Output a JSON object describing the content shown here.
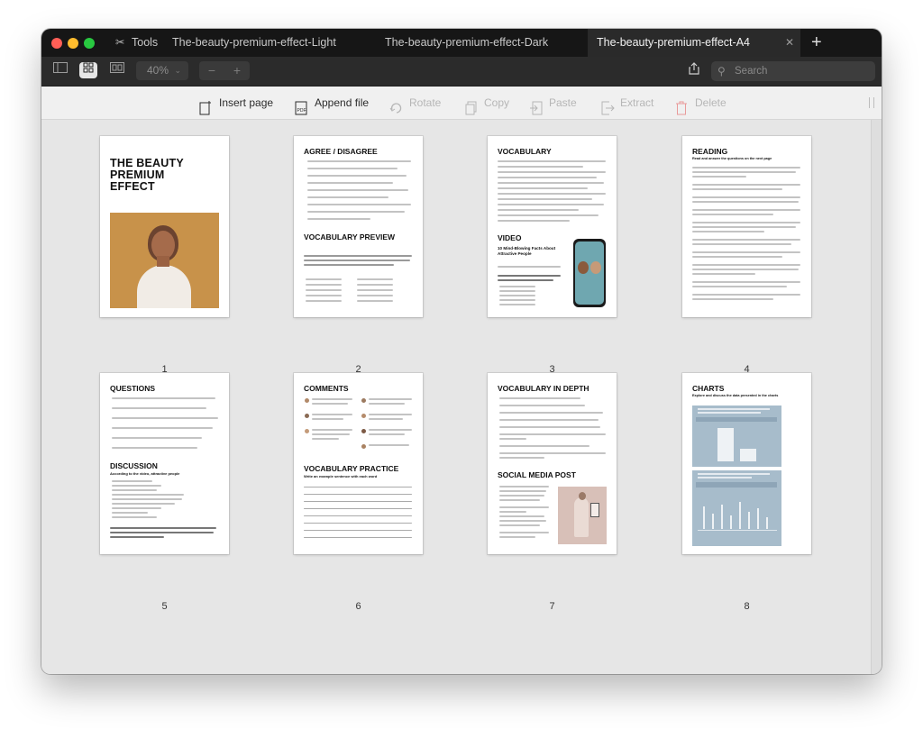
{
  "window": {
    "tabs": {
      "tools_label": "Tools",
      "tab1": "The-beauty-premium-effect-Light",
      "tab2": "The-beauty-premium-effect-Dark",
      "tab3": "The-beauty-premium-effect-A4"
    }
  },
  "toolbar": {
    "zoom": "40%",
    "search_placeholder": "Search"
  },
  "actions": {
    "insert_page": "Insert page",
    "append_file": "Append file",
    "rotate": "Rotate",
    "copy": "Copy",
    "paste": "Paste",
    "extract": "Extract",
    "delete": "Delete"
  },
  "pages": [
    {
      "number": "1",
      "title": "THE BEAUTY PREMIUM EFFECT"
    },
    {
      "number": "2",
      "title": "AGREE / DISAGREE",
      "title2": "VOCABULARY PREVIEW"
    },
    {
      "number": "3",
      "title": "VOCABULARY",
      "title2": "VIDEO",
      "sub2": "10 Mind-Blowing Facts About Attractive People"
    },
    {
      "number": "4",
      "title": "READING",
      "sub": "Read and answer the questions on the next page"
    },
    {
      "number": "5",
      "title": "QUESTIONS",
      "title2": "DISCUSSION",
      "sub2": "According to the video, attractive people"
    },
    {
      "number": "6",
      "title": "COMMENTS",
      "title2": "VOCABULARY PRACTICE",
      "sub2": "Write an example sentence with each word"
    },
    {
      "number": "7",
      "title": "VOCABULARY IN DEPTH",
      "title2": "SOCIAL MEDIA POST"
    },
    {
      "number": "8",
      "title": "CHARTS",
      "sub": "Explore and discuss the data presented in the charts"
    }
  ],
  "colors": {
    "accent_warm": "#c8924a",
    "chart_blue": "#a7bccb",
    "tab_bg": "#161616"
  }
}
